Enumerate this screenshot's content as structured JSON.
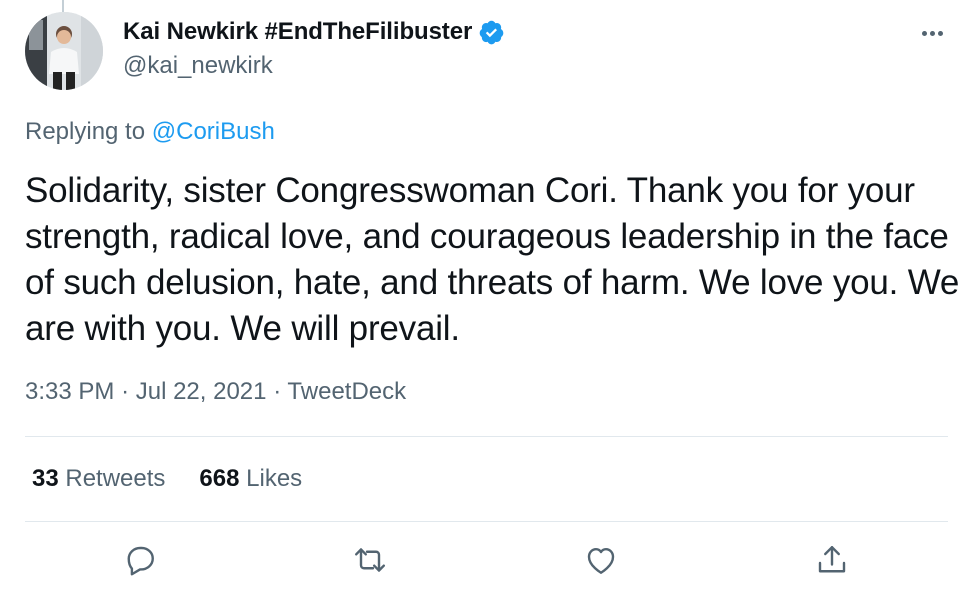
{
  "tweet": {
    "author": {
      "display_name": "Kai Newkirk #EndTheFilibuster",
      "handle": "@kai_newkirk",
      "verified": true,
      "avatar": "profile-photo"
    },
    "reply_prefix": "Replying to",
    "reply_to": "@CoriBush",
    "text": "Solidarity, sister Congresswoman Cori. Thank you for your strength, radical love, and courageous leadership in the face of such delusion, hate, and threats of harm. We love you. We are with you. We will prevail.",
    "time": "3:33 PM",
    "separator": "·",
    "date": "Jul 22, 2021",
    "source": "TweetDeck"
  },
  "stats": {
    "retweets_count": "33",
    "retweets_label": "Retweets",
    "likes_count": "668",
    "likes_label": "Likes"
  },
  "actions": [
    "reply-icon",
    "retweet-icon",
    "like-icon",
    "share-icon"
  ],
  "colors": {
    "accent": "#1d9bf0",
    "text_primary": "#0f1419",
    "text_secondary": "#536471",
    "divider": "#e1e8ed"
  }
}
